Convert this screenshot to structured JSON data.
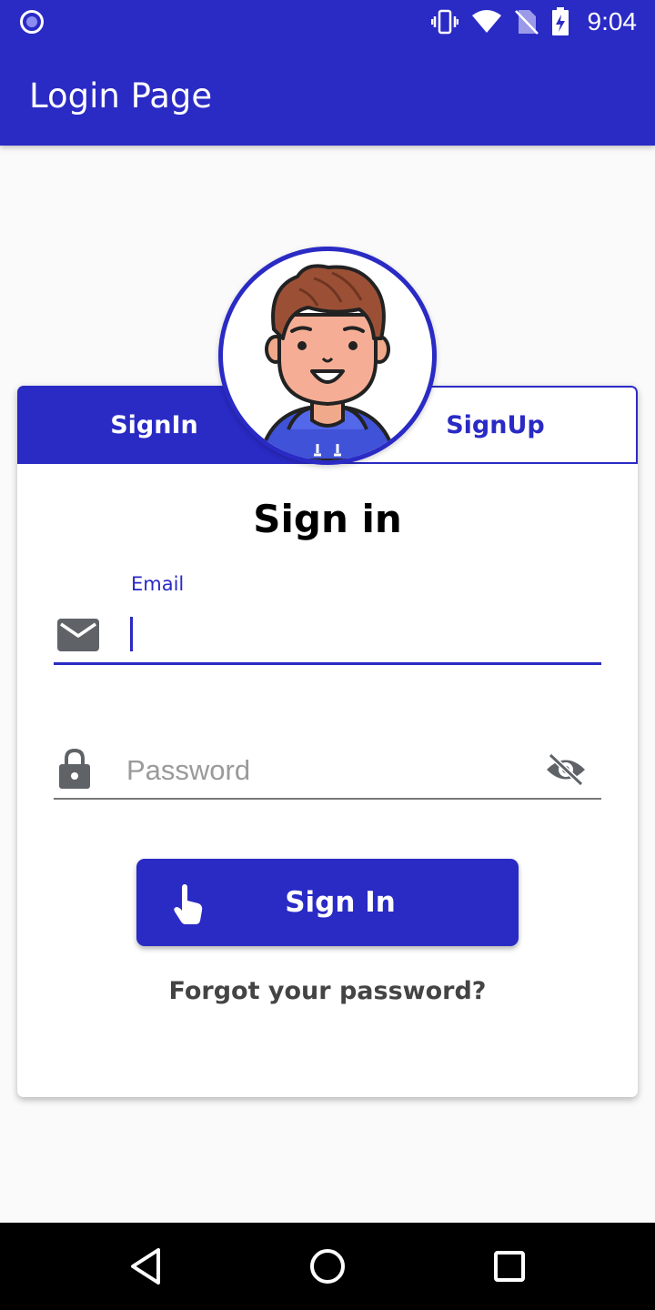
{
  "status_bar": {
    "time": "9:04",
    "icons": [
      "vibrate-icon",
      "wifi-icon",
      "no-sim-icon",
      "battery-charging-icon"
    ]
  },
  "app_bar": {
    "title": "Login Page"
  },
  "tabs": [
    {
      "label": "SignIn",
      "active": true
    },
    {
      "label": "SignUp",
      "active": false
    }
  ],
  "form": {
    "title": "Sign in",
    "email": {
      "label": "Email",
      "value": "",
      "icon": "mail-icon"
    },
    "password": {
      "placeholder": "Password",
      "value": "",
      "icon": "lock-icon",
      "toggle_icon": "eye-off-icon"
    },
    "submit": {
      "label": "Sign In",
      "icon": "hand-pointer-icon"
    },
    "forgot_link": "Forgot your password?"
  },
  "colors": {
    "primary": "#2a2ac5",
    "background": "#fafafa"
  },
  "nav_bar": [
    "back-icon",
    "home-icon",
    "recents-icon"
  ]
}
